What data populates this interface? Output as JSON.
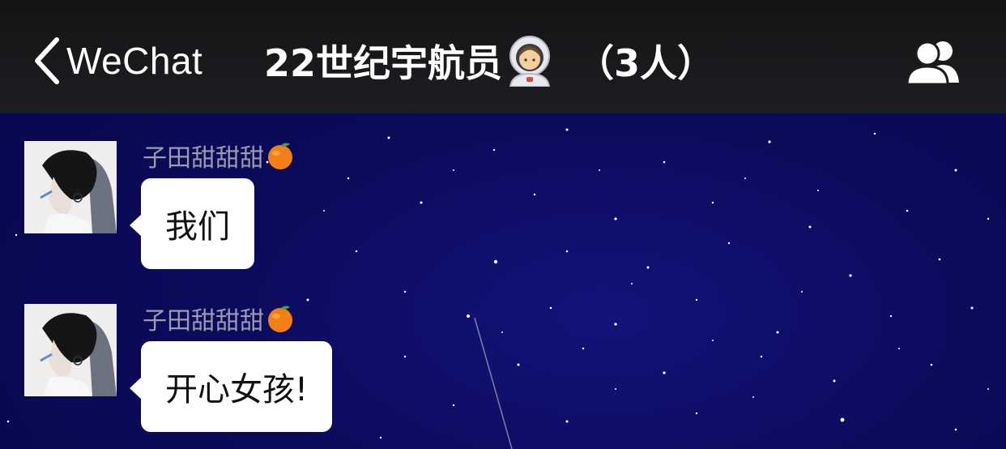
{
  "header": {
    "back_label": "WeChat",
    "title": "22世纪宇航员",
    "title_emoji": "astronaut-emoji",
    "member_count": "（3人）",
    "members_icon": "group-members-icon"
  },
  "messages": [
    {
      "sender": "子田甜甜甜",
      "sender_emoji": "tangerine-emoji",
      "text": "我们"
    },
    {
      "sender": "子田甜甜甜",
      "sender_emoji": "tangerine-emoji",
      "text": "开心女孩!"
    }
  ],
  "colors": {
    "header_bg": "#1a1a1d",
    "chat_bg": "#0b0b5c",
    "bubble_bg": "#ffffff",
    "sender_name": "#9b9bb0"
  }
}
